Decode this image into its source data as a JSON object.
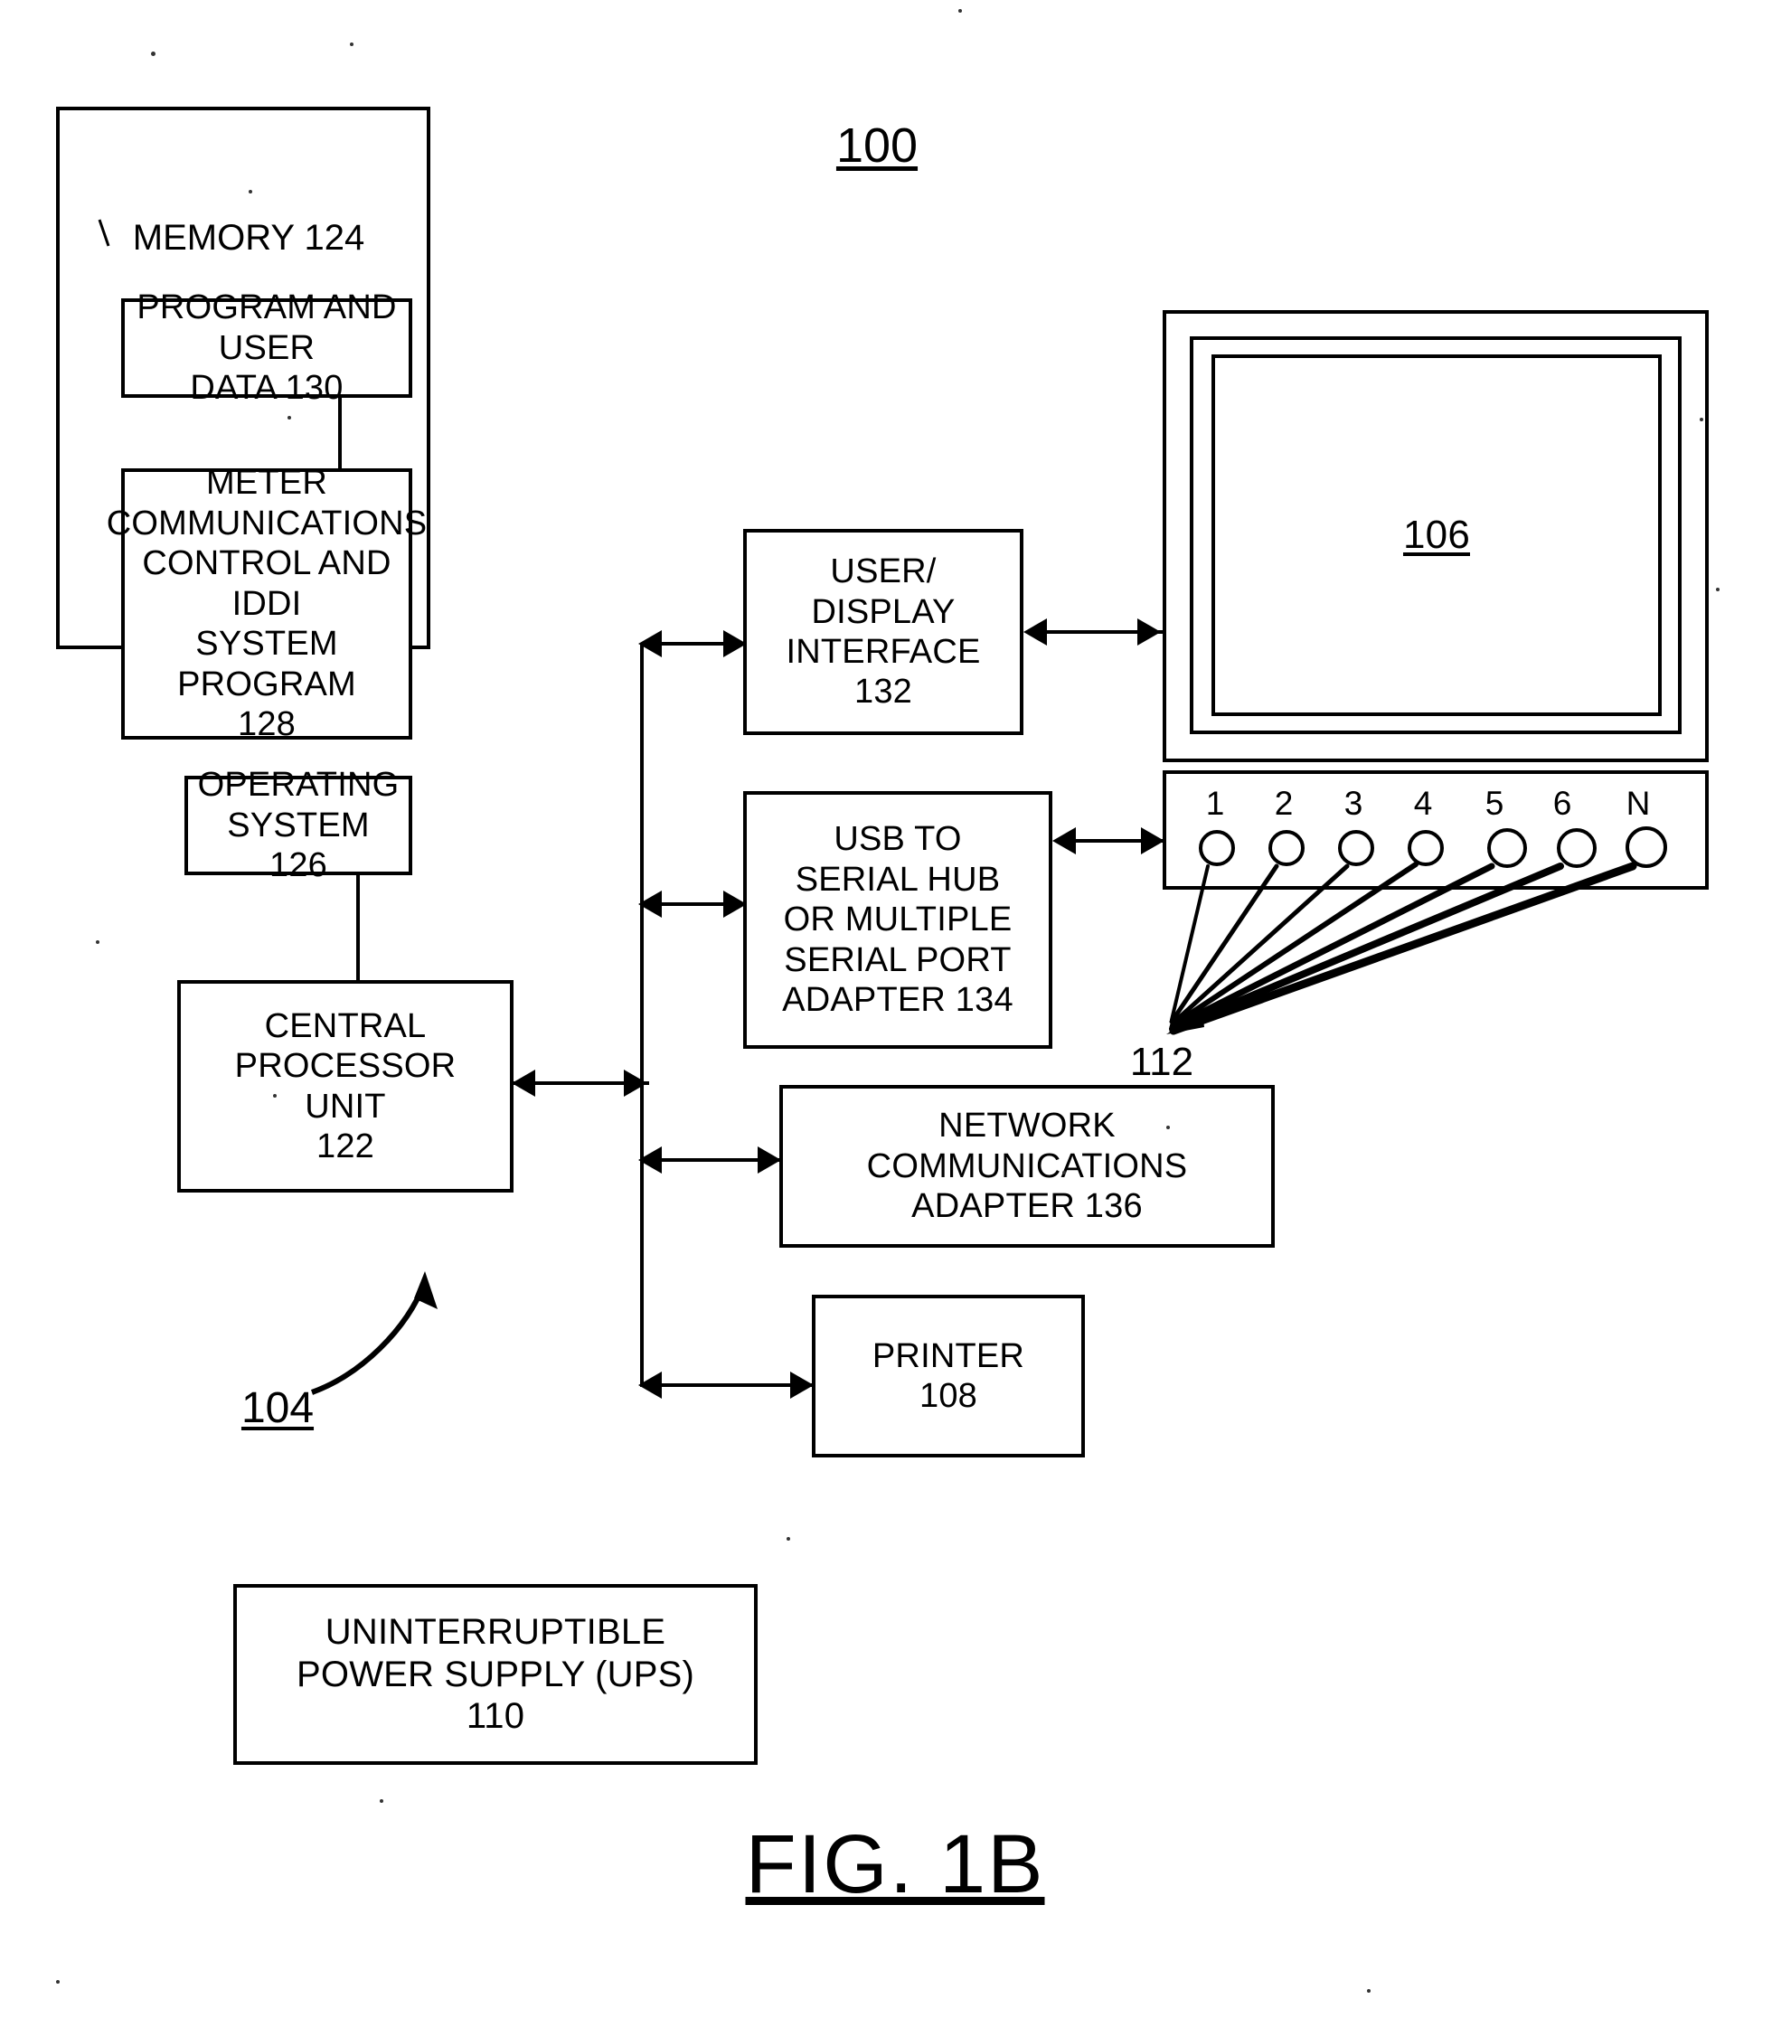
{
  "figure": {
    "number_label": "100",
    "caption": "FIG. 1B",
    "system_ref": "104"
  },
  "memory": {
    "title": "MEMORY 124",
    "blocks": {
      "program_user_data": "PROGRAM AND USER\nDATA 130",
      "meter_comm": "METER\nCOMMUNICATIONS\nCONTROL AND IDDI\nSYSTEM PROGRAM\n128",
      "operating_system": "OPERATING\nSYSTEM 126"
    }
  },
  "cpu": {
    "label": "CENTRAL\nPROCESSOR\nUNIT\n122"
  },
  "peripherals": [
    {
      "id": "user-display-interface",
      "label": "USER/\nDISPLAY\nINTERFACE\n132"
    },
    {
      "id": "usb-serial-hub",
      "label": "USB TO\nSERIAL HUB\nOR MULTIPLE\nSERIAL PORT\nADAPTER 134"
    },
    {
      "id": "network-comm-adapter",
      "label": "NETWORK\nCOMMUNICATIONS\nADAPTER 136"
    },
    {
      "id": "printer",
      "label": "PRINTER\n108"
    }
  ],
  "monitor": {
    "screen_ref": "106",
    "ports_ref": "112",
    "ports": [
      "1",
      "2",
      "3",
      "4",
      "5",
      "6",
      "N"
    ]
  },
  "ups": {
    "label": "UNINTERRUPTIBLE\nPOWER SUPPLY (UPS)\n110"
  },
  "colors": {
    "ink": "#000000",
    "paper": "#ffffff"
  }
}
